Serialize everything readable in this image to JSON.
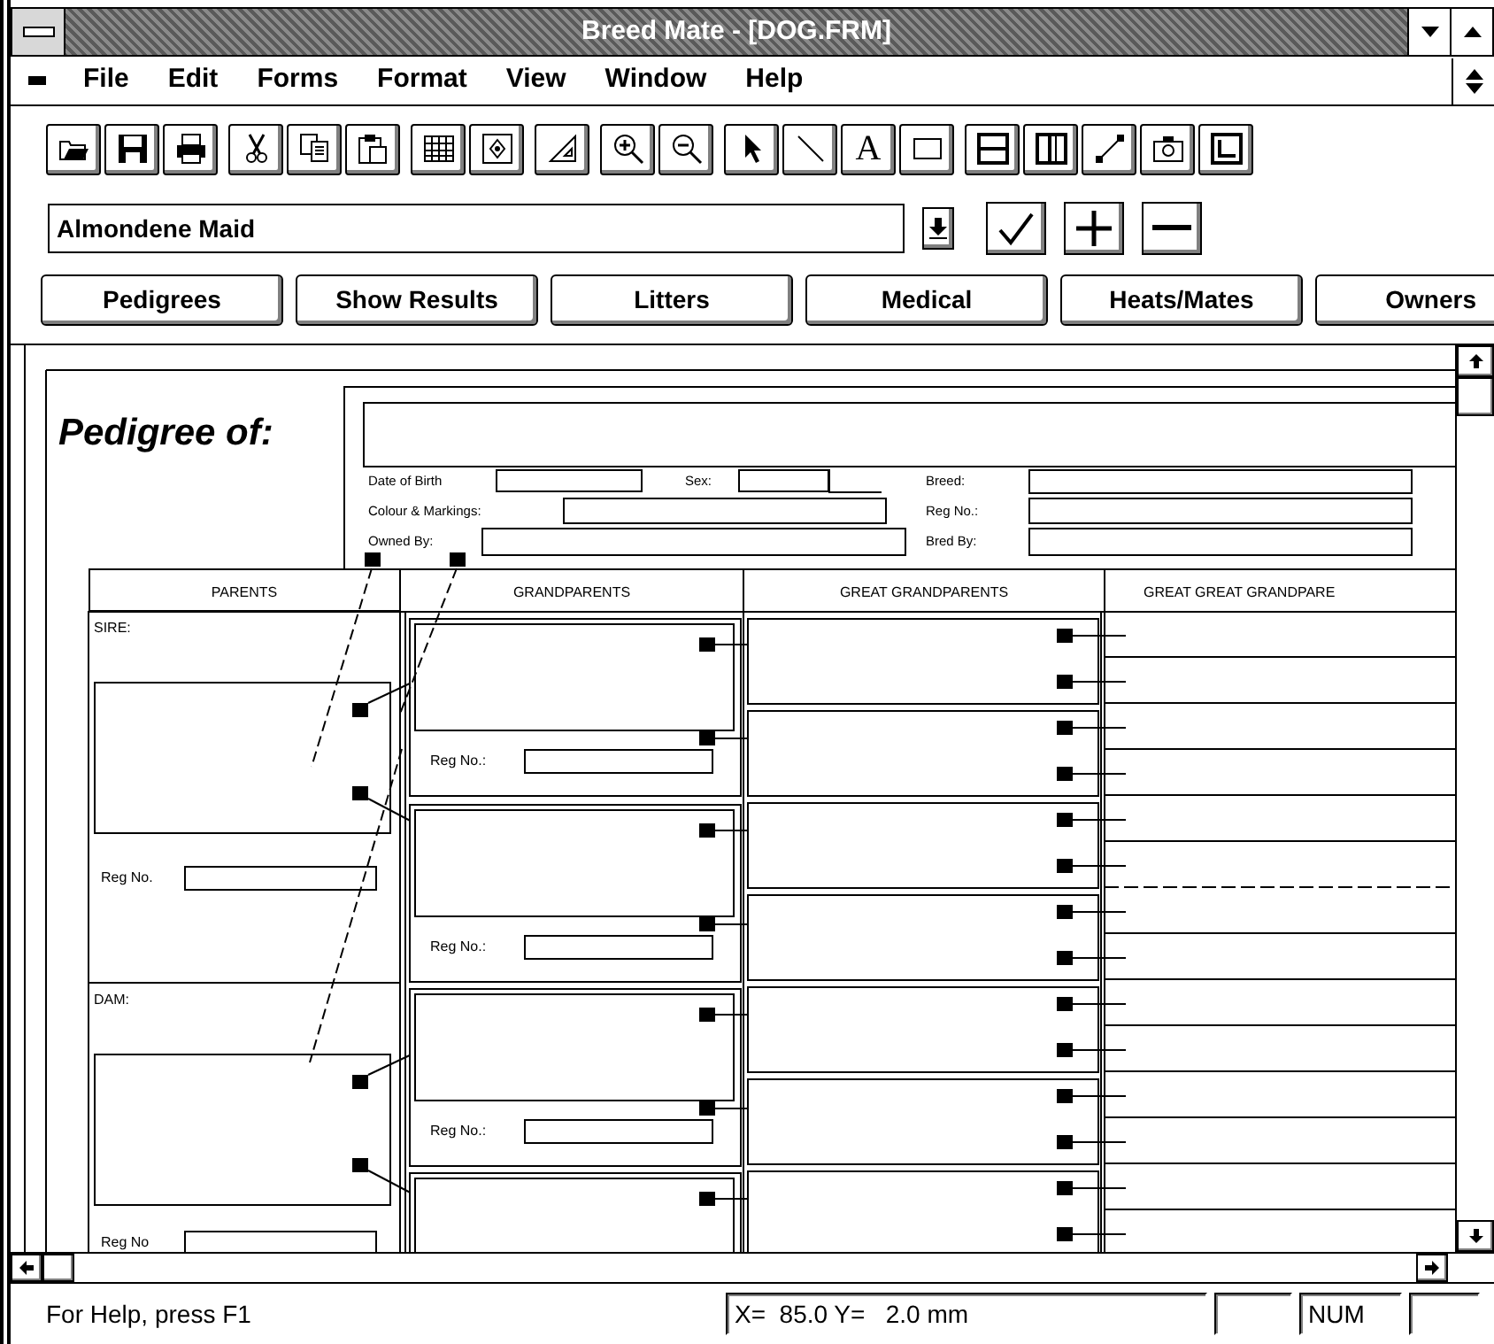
{
  "window": {
    "title": "Breed Mate - [DOG.FRM]"
  },
  "menu": [
    "File",
    "Edit",
    "Forms",
    "Format",
    "View",
    "Window",
    "Help"
  ],
  "toolbar": [
    {
      "tools": [
        {
          "kind": "open"
        },
        {
          "kind": "save"
        },
        {
          "kind": "print"
        }
      ]
    },
    {
      "tools": [
        {
          "kind": "cut"
        },
        {
          "kind": "copy"
        },
        {
          "kind": "paste"
        }
      ]
    },
    {
      "tools": [
        {
          "kind": "grid"
        },
        {
          "kind": "node"
        }
      ]
    },
    {
      "tools": [
        {
          "kind": "triangle"
        }
      ]
    },
    {
      "tools": [
        {
          "kind": "zoom-in"
        },
        {
          "kind": "zoom-out"
        }
      ]
    },
    {
      "tools": [
        {
          "kind": "pointer"
        },
        {
          "kind": "line"
        },
        {
          "kind": "text",
          "label": "A"
        },
        {
          "kind": "rectangle"
        }
      ]
    },
    {
      "tools": [
        {
          "kind": "hsplit"
        },
        {
          "kind": "vsplit"
        },
        {
          "kind": "connector"
        },
        {
          "kind": "camera"
        },
        {
          "kind": "frame"
        }
      ]
    }
  ],
  "record": {
    "name": "Almondene Maid",
    "buttons": [
      {
        "kind": "dropdown"
      },
      {
        "kind": "check"
      },
      {
        "kind": "plus"
      },
      {
        "kind": "minus"
      }
    ]
  },
  "tabs": [
    "Pedigrees",
    "Show Results",
    "Litters",
    "Medical",
    "Heats/Mates",
    "Owners"
  ],
  "form": {
    "heading": "Pedigree of:",
    "details": [
      {
        "label": "Date of Birth"
      },
      {
        "label": "Sex:"
      },
      {
        "label": "Breed:"
      },
      {
        "label": "Colour & Markings:"
      },
      {
        "label": "Reg No.:"
      },
      {
        "label": "Owned By:"
      },
      {
        "label": "Bred By:"
      }
    ],
    "columns": [
      "PARENTS",
      "GRANDPARENTS",
      "GREAT GRANDPARENTS",
      "GREAT GREAT GRANDPARE"
    ],
    "parents": [
      {
        "label": "SIRE:",
        "reg_label": "Reg No."
      },
      {
        "label": "DAM:",
        "reg_label": "Reg No"
      }
    ],
    "grandparents": [
      {
        "reg_label": "Reg No.:"
      },
      {
        "reg_label": "Reg No.:"
      },
      {
        "reg_label": "Reg No.:"
      }
    ]
  },
  "status_bar": {
    "help": "For Help, press F1",
    "position": "X=  85.0 Y=   2.0 mm",
    "num": "NUM"
  }
}
